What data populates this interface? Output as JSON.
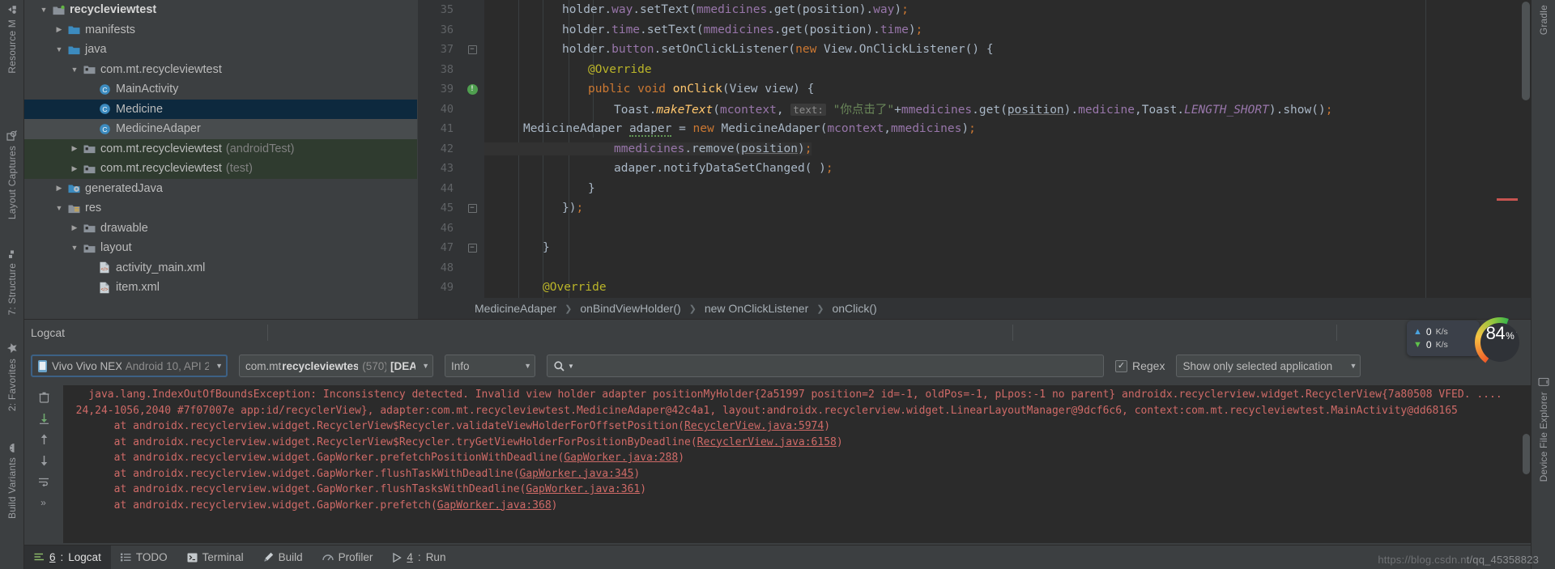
{
  "left_strip": [
    {
      "label": "Resource M",
      "icon": "resource-manager-icon"
    },
    {
      "label": "Layout Captures",
      "icon": "layout-captures-icon"
    },
    {
      "label": "7: Structure",
      "icon": "structure-icon"
    },
    {
      "label": "2: Favorites",
      "icon": "star-icon"
    },
    {
      "label": "Build Variants",
      "icon": "android-icon"
    }
  ],
  "right_strip": [
    {
      "label": "Gradle",
      "icon": "gradle-icon"
    },
    {
      "label": "Device File Explorer",
      "icon": "device-file-explorer-icon"
    }
  ],
  "project_tree": [
    {
      "depth": 0,
      "arrow": "down",
      "label": "recycleviewtest",
      "suffix": "",
      "icon": "module-icon",
      "state": "bold"
    },
    {
      "depth": 1,
      "arrow": "right",
      "label": "manifests",
      "suffix": "",
      "icon": "folder-icon",
      "state": ""
    },
    {
      "depth": 1,
      "arrow": "down",
      "label": "java",
      "suffix": "",
      "icon": "folder-icon",
      "state": ""
    },
    {
      "depth": 2,
      "arrow": "down",
      "label": "com.mt.recycleviewtest",
      "suffix": "",
      "icon": "package-icon",
      "state": ""
    },
    {
      "depth": 3,
      "arrow": "none",
      "label": "MainActivity",
      "suffix": "",
      "icon": "class-icon",
      "state": ""
    },
    {
      "depth": 3,
      "arrow": "none",
      "label": "Medicine",
      "suffix": "",
      "icon": "class-icon",
      "state": "sel"
    },
    {
      "depth": 3,
      "arrow": "none",
      "label": "MedicineAdaper",
      "suffix": "",
      "icon": "class-icon",
      "state": "hl"
    },
    {
      "depth": 2,
      "arrow": "right",
      "label": "com.mt.recycleviewtest",
      "suffix": "(androidTest)",
      "icon": "package-icon",
      "state": "green"
    },
    {
      "depth": 2,
      "arrow": "right",
      "label": "com.mt.recycleviewtest",
      "suffix": "(test)",
      "icon": "package-icon",
      "state": "green"
    },
    {
      "depth": 1,
      "arrow": "right",
      "label": "generatedJava",
      "suffix": "",
      "icon": "generated-icon",
      "state": ""
    },
    {
      "depth": 1,
      "arrow": "down",
      "label": "res",
      "suffix": "",
      "icon": "res-icon",
      "state": ""
    },
    {
      "depth": 2,
      "arrow": "right",
      "label": "drawable",
      "suffix": "",
      "icon": "package-icon",
      "state": ""
    },
    {
      "depth": 2,
      "arrow": "down",
      "label": "layout",
      "suffix": "",
      "icon": "package-icon",
      "state": ""
    },
    {
      "depth": 3,
      "arrow": "none",
      "label": "activity_main.xml",
      "suffix": "",
      "icon": "xml-icon",
      "state": ""
    },
    {
      "depth": 3,
      "arrow": "none",
      "label": "item.xml",
      "suffix": "",
      "icon": "xml-icon",
      "state": ""
    }
  ],
  "editor": {
    "first_line_number": 35,
    "lines": [
      {
        "n": 35,
        "marker": "",
        "highlight": false
      },
      {
        "n": 36,
        "marker": "",
        "highlight": false
      },
      {
        "n": 37,
        "marker": "fold",
        "highlight": false
      },
      {
        "n": 38,
        "marker": "",
        "highlight": false
      },
      {
        "n": 39,
        "marker": "bulb",
        "highlight": false
      },
      {
        "n": 40,
        "marker": "",
        "highlight": false
      },
      {
        "n": 41,
        "marker": "",
        "highlight": false
      },
      {
        "n": 42,
        "marker": "",
        "highlight": true
      },
      {
        "n": 43,
        "marker": "",
        "highlight": false
      },
      {
        "n": 44,
        "marker": "",
        "highlight": false
      },
      {
        "n": 45,
        "marker": "fold",
        "highlight": false
      },
      {
        "n": 46,
        "marker": "",
        "highlight": false
      },
      {
        "n": 47,
        "marker": "fold",
        "highlight": false
      },
      {
        "n": 48,
        "marker": "",
        "highlight": false
      },
      {
        "n": 49,
        "marker": "",
        "highlight": false
      }
    ],
    "code_text": {
      "l35": "            holder.way.setText(mmedicines.get(position).way);",
      "l36": "            holder.time.setText(mmedicines.get(position).time);",
      "l37": "            holder.button.setOnClickListener(new View.OnClickListener() {",
      "l38": "                @Override",
      "l39": "                public void onClick(View view) {",
      "l40": "                    Toast.makeText(mcontext,  text: \"你点击了\"+mmedicines.get(position).medicine,Toast.LENGTH_SHORT).show();",
      "l41": "    MedicineAdaper adaper = new MedicineAdaper(mcontext,mmedicines);",
      "l42": "                    mmedicines.remove(position);",
      "l43": "                    adaper.notifyDataSetChanged();",
      "l44": "                }",
      "l45": "            });",
      "l46": "",
      "l47": "        }",
      "l48": "",
      "l49": "        @Override"
    }
  },
  "breadcrumb": [
    "MedicineAdaper",
    "onBindViewHolder()",
    "new OnClickListener",
    "onClick()"
  ],
  "logcat": {
    "panel_title": "Logcat",
    "device": {
      "name": "Vivo Vivo NEX",
      "details": "Android 10, API 2"
    },
    "process": {
      "package_prefix": "com.mt.",
      "package_bold": "recycleviewtest",
      "pid": "(570)",
      "state": "[DEA"
    },
    "level": "Info",
    "search_placeholder": "",
    "regex_label": "Regex",
    "regex_checked": true,
    "filter": "Show only selected application",
    "lines": [
      "    java.lang.IndexOutOfBoundsException: Inconsistency detected. Invalid view holder adapter positionMyHolder{2a51997 position=2 id=-1, oldPos=-1, pLpos:-1 no parent} androidx.recyclerview.widget.RecyclerView{7a80508 VFED. ....",
      "  24,24-1056,2040 #7f07007e app:id/recyclerView}, adapter:com.mt.recycleviewtest.MedicineAdaper@42c4a1, layout:androidx.recyclerview.widget.LinearLayoutManager@9dcf6c6, context:com.mt.recycleviewtest.MainActivity@dd68165",
      "        at androidx.recyclerview.widget.RecyclerView$Recycler.validateViewHolderForOffsetPosition(RecyclerView.java:5974)",
      "        at androidx.recyclerview.widget.RecyclerView$Recycler.tryGetViewHolderForPositionByDeadline(RecyclerView.java:6158)",
      "        at androidx.recyclerview.widget.GapWorker.prefetchPositionWithDeadline(GapWorker.java:288)",
      "        at androidx.recyclerview.widget.GapWorker.flushTaskWithDeadline(GapWorker.java:345)",
      "        at androidx.recyclerview.widget.GapWorker.flushTasksWithDeadline(GapWorker.java:361)",
      "        at androidx.recyclerview.widget.GapWorker.prefetch(GapWorker.java:368)"
    ],
    "gutter_icons": [
      "trash-icon",
      "scroll-to-end-icon",
      "up-icon",
      "down-icon",
      "wrap-icon",
      "more-icon"
    ]
  },
  "bottom_tabs": [
    {
      "num": "6",
      "label": "Logcat",
      "icon": "logcat-icon",
      "active": true
    },
    {
      "num": "",
      "label": "TODO",
      "icon": "todo-icon",
      "active": false
    },
    {
      "num": "",
      "label": "Terminal",
      "icon": "terminal-icon",
      "active": false
    },
    {
      "num": "",
      "label": "Build",
      "icon": "build-icon",
      "active": false
    },
    {
      "num": "",
      "label": "Profiler",
      "icon": "profiler-icon",
      "active": false
    },
    {
      "num": "4",
      "label": "Run",
      "icon": "run-icon",
      "active": false
    }
  ],
  "widgets": {
    "net_up": "0",
    "net_up_unit": "K/s",
    "net_down": "0",
    "net_down_unit": "K/s",
    "cpu_value": "84",
    "cpu_unit": "%"
  },
  "watermark": {
    "part1": "https://blog.csdn.n",
    "part2": "t/qq_45358823"
  },
  "colors": {
    "accent": "#3d6185",
    "error": "#cf6a67",
    "selection": "#0d293e",
    "green_row": "#2f3b2f",
    "editor_bg": "#2b2b2b",
    "chrome_bg": "#3c3f41"
  }
}
